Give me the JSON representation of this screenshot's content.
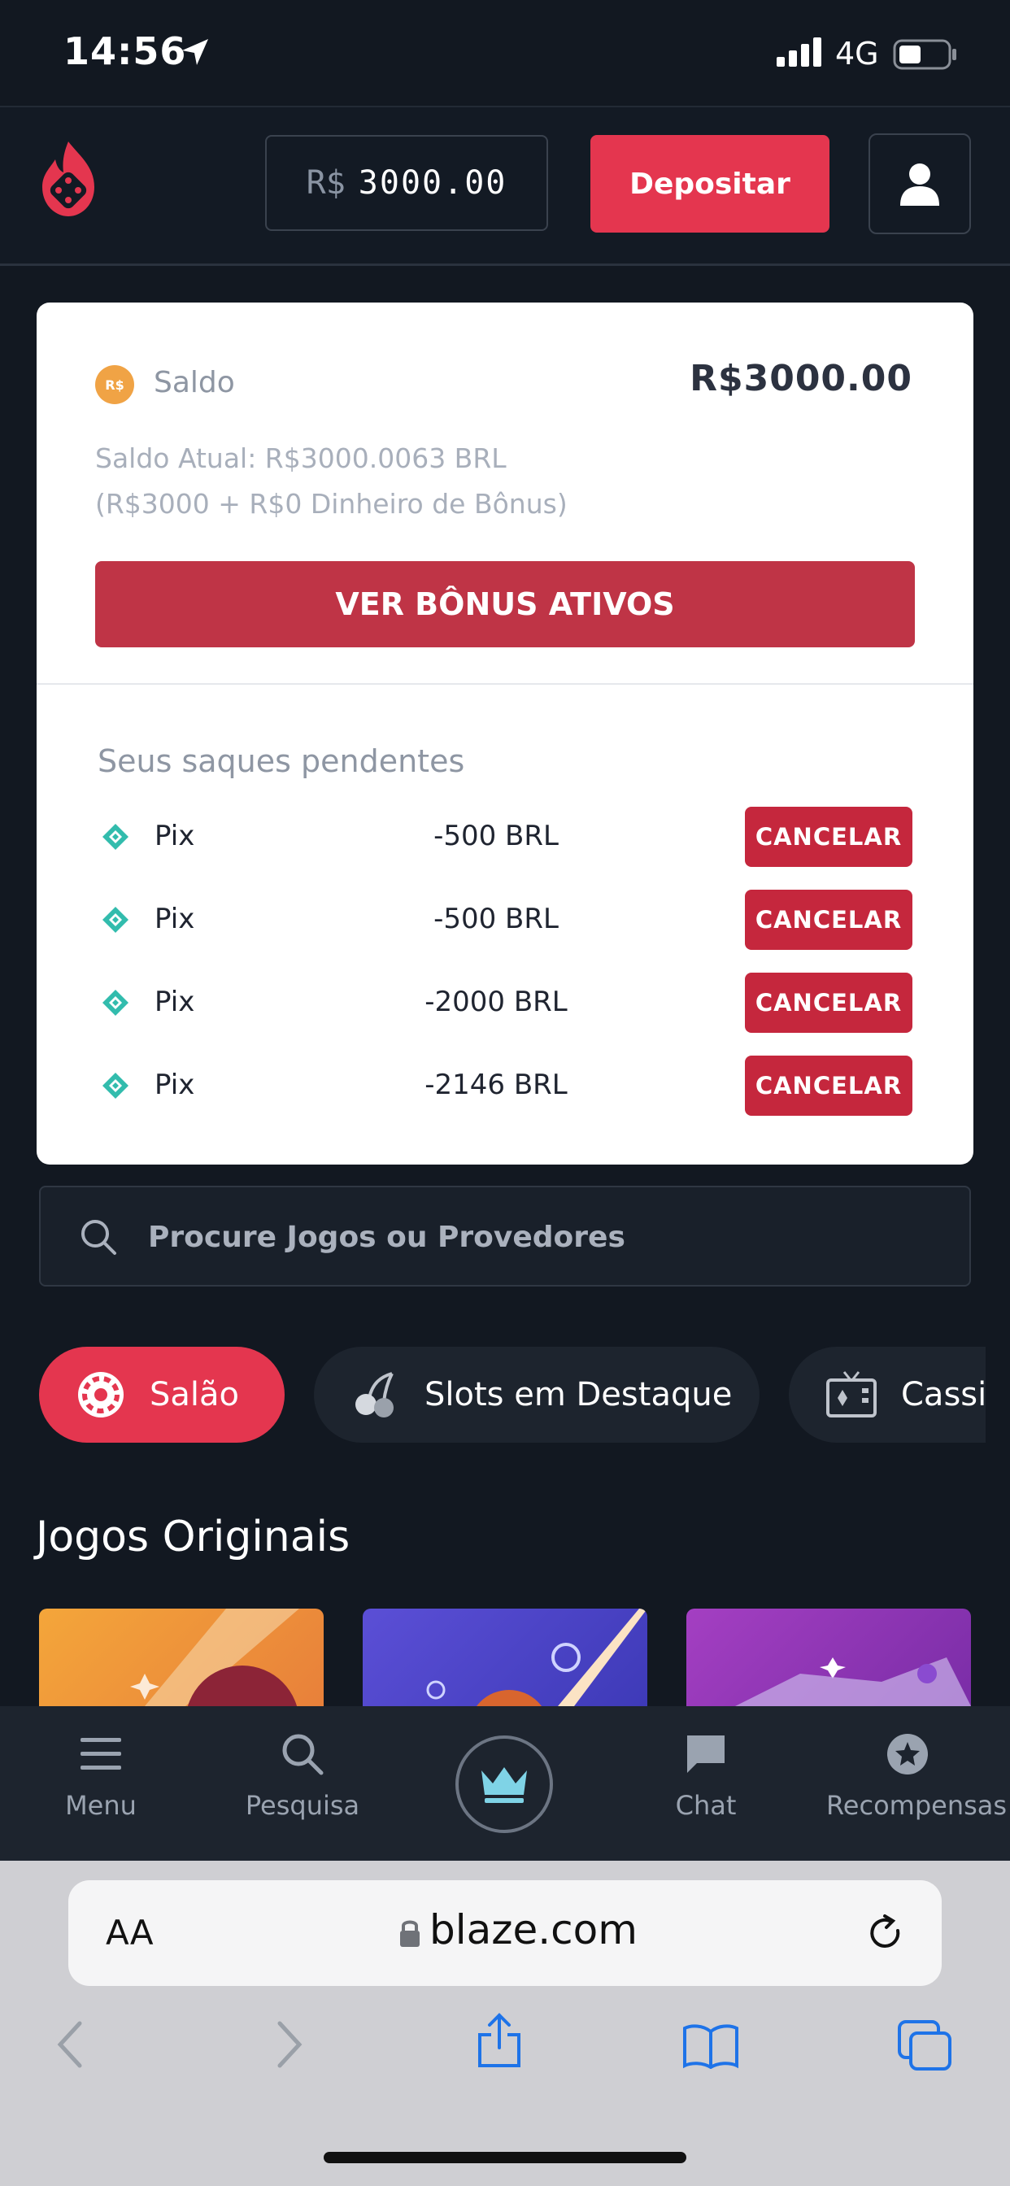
{
  "status_bar": {
    "time": "14:56",
    "network": "4G"
  },
  "header": {
    "balance_currency": "R$",
    "balance_value": "3000.00",
    "deposit_label": "Depositar"
  },
  "wallet": {
    "currency_badge": "R$",
    "saldo_label": "Saldo",
    "saldo_value": "R$3000.00",
    "saldo_atual": "Saldo Atual: R$3000.0063 BRL",
    "saldo_breakdown": "(R$3000 + R$0 Dinheiro de Bônus)",
    "ver_bonus_label": "VER BÔNUS ATIVOS",
    "pending_title": "Seus saques pendentes",
    "withdrawals": [
      {
        "method": "Pix",
        "amount": "-500 BRL",
        "action": "CANCELAR"
      },
      {
        "method": "Pix",
        "amount": "-500 BRL",
        "action": "CANCELAR"
      },
      {
        "method": "Pix",
        "amount": "-2000 BRL",
        "action": "CANCELAR"
      },
      {
        "method": "Pix",
        "amount": "-2146 BRL",
        "action": "CANCELAR"
      }
    ]
  },
  "search": {
    "placeholder": "Procure Jogos ou Provedores"
  },
  "categories": [
    {
      "label": "Salão",
      "icon": "roulette-icon"
    },
    {
      "label": "Slots em Destaque",
      "icon": "cherries-icon"
    },
    {
      "label": "Cassi",
      "icon": "tv-cards-icon"
    }
  ],
  "section_title": "Jogos Originais",
  "bottom_nav": [
    {
      "label": "Menu",
      "icon": "menu-icon"
    },
    {
      "label": "Pesquisa",
      "icon": "search-icon"
    },
    {
      "label": "",
      "icon": "crown-icon"
    },
    {
      "label": "Chat",
      "icon": "chat-icon"
    },
    {
      "label": "Recompensas",
      "icon": "star-badge-icon"
    }
  ],
  "browser": {
    "text_size_label": "AA",
    "url": "blaze.com"
  },
  "colors": {
    "brand_red": "#e4364f",
    "cancel_red": "#c5273d",
    "background": "#121821",
    "pix_teal": "#32bcad"
  }
}
